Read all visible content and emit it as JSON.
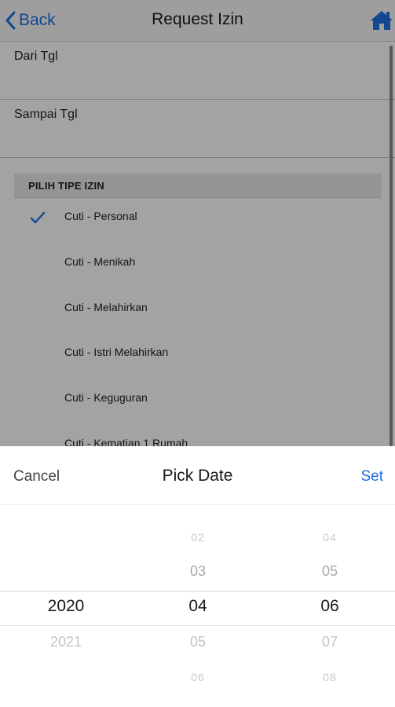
{
  "navbar": {
    "back_label": "Back",
    "title": "Request Izin",
    "home_icon": "home-icon"
  },
  "form": {
    "dari_label": "Dari Tgl",
    "sampai_label": "Sampai Tgl",
    "section_title": "PILIH TIPE IZIN",
    "options": [
      {
        "label": "Cuti - Personal",
        "selected": true
      },
      {
        "label": "Cuti - Menikah",
        "selected": false
      },
      {
        "label": "Cuti - Melahirkan",
        "selected": false
      },
      {
        "label": "Cuti - Istri Melahirkan",
        "selected": false
      },
      {
        "label": "Cuti - Keguguran",
        "selected": false
      },
      {
        "label": "Cuti - Kematian 1 Rumah",
        "selected": false
      }
    ]
  },
  "picker": {
    "cancel_label": "Cancel",
    "title": "Pick Date",
    "set_label": "Set",
    "year": {
      "above": [
        "",
        ""
      ],
      "selected": "2020",
      "below": [
        "2021",
        ""
      ]
    },
    "month": {
      "above": [
        "02",
        "03"
      ],
      "selected": "04",
      "below": [
        "05",
        "06"
      ]
    },
    "day": {
      "above": [
        "04",
        "05"
      ],
      "selected": "06",
      "below": [
        "07",
        "08"
      ]
    }
  },
  "colors": {
    "accent": "#1f6fe0",
    "overlay": "rgba(0,0,0,0.36)"
  }
}
